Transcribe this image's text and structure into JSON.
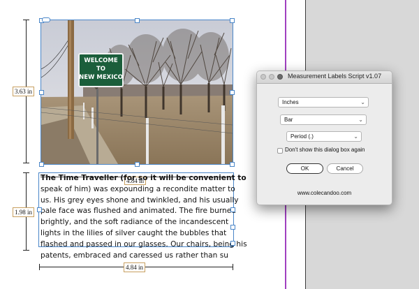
{
  "document": {
    "image_width_label": "4.84 in",
    "image_height_label": "3.63 in",
    "text_height_label": "1.98 in",
    "text_width_label": "4.84 in",
    "sign_text": [
      "WELCOME",
      "TO",
      "NEW MEXICO"
    ],
    "body_lines": [
      "The Time Traveller (for so it will be convenient to",
      "speak of him) was expounding a recondite matter to",
      "us. His grey eyes shone and twinkled, and his usually",
      "pale face was flushed and animated. The fire burned",
      "brightly, and the soft radiance of the incandescent",
      "lights in the lilies of silver caught the bubbles that",
      "flashed and passed in our glasses. Our chairs, being his",
      "patents, embraced and caressed us rather than su"
    ]
  },
  "dialog": {
    "title": "Measurement Labels Script v1.07",
    "units_select": "Inches",
    "style_select": "Bar",
    "decimal_select": "Period (.)",
    "checkbox_label": "Don't show this dialog box again",
    "checkbox_checked": false,
    "ok_label": "OK",
    "cancel_label": "Cancel",
    "website": "www.colecandoo.com"
  },
  "colors": {
    "frame_selection": "#4a86c8",
    "page_edge": "#a040c0",
    "pasteboard": "#d8d8d8",
    "label_border": "#c8a060"
  }
}
